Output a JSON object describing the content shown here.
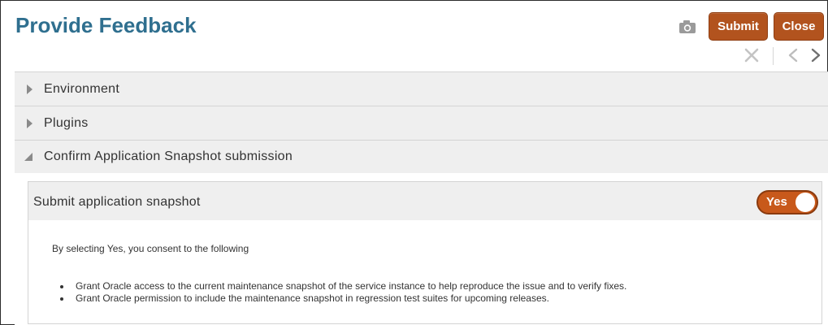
{
  "header": {
    "title": "Provide Feedback",
    "camera_icon": "camera-icon",
    "submit_label": "Submit",
    "close_label": "Close",
    "accent_color": "#b2531e"
  },
  "nav": {
    "clear_icon": "close-icon",
    "prev_icon": "chevron-left-icon",
    "next_icon": "chevron-right-icon"
  },
  "accordion": {
    "items": [
      {
        "label": "Environment",
        "expanded": false
      },
      {
        "label": "Plugins",
        "expanded": false
      },
      {
        "label": "Confirm Application Snapshot submission",
        "expanded": true
      }
    ]
  },
  "snapshot": {
    "section_title": "Submit application snapshot",
    "toggle_label": "Yes",
    "toggle_on": true,
    "consent_text": "By selecting Yes, you consent to the following",
    "bullets": [
      "Grant Oracle access to the current maintenance snapshot of the service instance to help reproduce the issue and to verify fixes.",
      "Grant Oracle permission to include the maintenance snapshot in regression test suites for upcoming releases."
    ]
  }
}
